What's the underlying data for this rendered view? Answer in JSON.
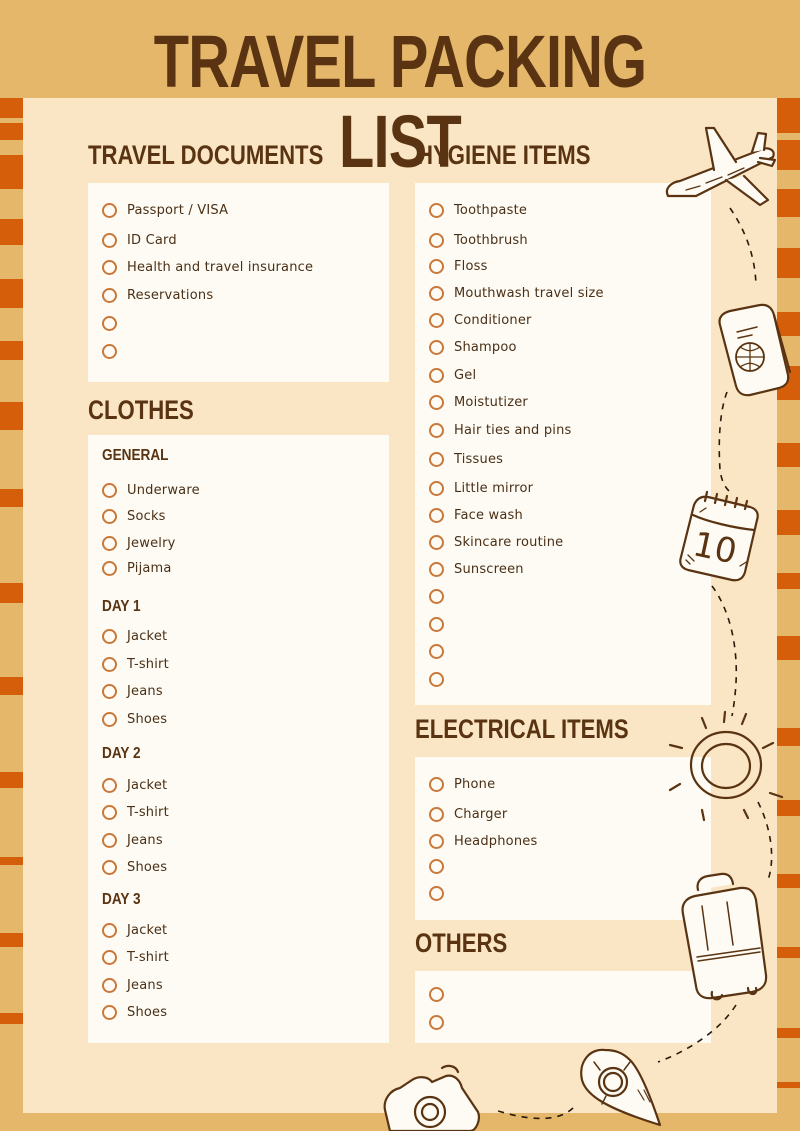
{
  "title": "TRAVEL PACKING LIST",
  "colors": {
    "background": "#E5B76A",
    "panel": "#FAE6C4",
    "box": "#FDFBF3",
    "text_dark": "#5A3412",
    "stripe_accent": "#D45E0A",
    "checkbox_outline": "#C9783A"
  },
  "sections": {
    "travel_documents": {
      "heading": "TRAVEL DOCUMENTS",
      "items": [
        "Passport / VISA",
        "ID Card",
        "Health and travel insurance",
        "Reservations",
        "",
        ""
      ]
    },
    "clothes": {
      "heading": "CLOTHES",
      "groups": [
        {
          "title": "GENERAL",
          "items": [
            "Underware",
            "Socks",
            "Jewelry",
            "Pijama"
          ]
        },
        {
          "title": "DAY 1",
          "items": [
            "Jacket",
            "T-shirt",
            "Jeans",
            "Shoes"
          ]
        },
        {
          "title": "DAY 2",
          "items": [
            "Jacket",
            "T-shirt",
            "Jeans",
            "Shoes"
          ]
        },
        {
          "title": "DAY 3",
          "items": [
            "Jacket",
            "T-shirt",
            "Jeans",
            "Shoes"
          ]
        }
      ]
    },
    "hygiene_items": {
      "heading": "HYGIENE ITEMS",
      "items": [
        "Toothpaste",
        "Toothbrush",
        "Floss",
        "Mouthwash travel size",
        "Conditioner",
        "Shampoo",
        "Gel",
        "Moistutizer",
        "Hair ties and pins",
        "Tissues",
        "Little mirror",
        "Face wash",
        "Skincare routine",
        "Sunscreen",
        "",
        "",
        "",
        ""
      ]
    },
    "electrical_items": {
      "heading": "ELECTRICAL ITEMS",
      "items": [
        "Phone",
        "Charger",
        "Headphones",
        "",
        ""
      ]
    },
    "others": {
      "heading": "OTHERS",
      "items": [
        "",
        ""
      ]
    }
  },
  "decorations": [
    "airplane-icon",
    "passport-icon",
    "calendar-icon",
    "calendar_number",
    "sun-icon",
    "suitcase-icon",
    "location-pin-icon",
    "camera-icon"
  ],
  "calendar_number": "10"
}
